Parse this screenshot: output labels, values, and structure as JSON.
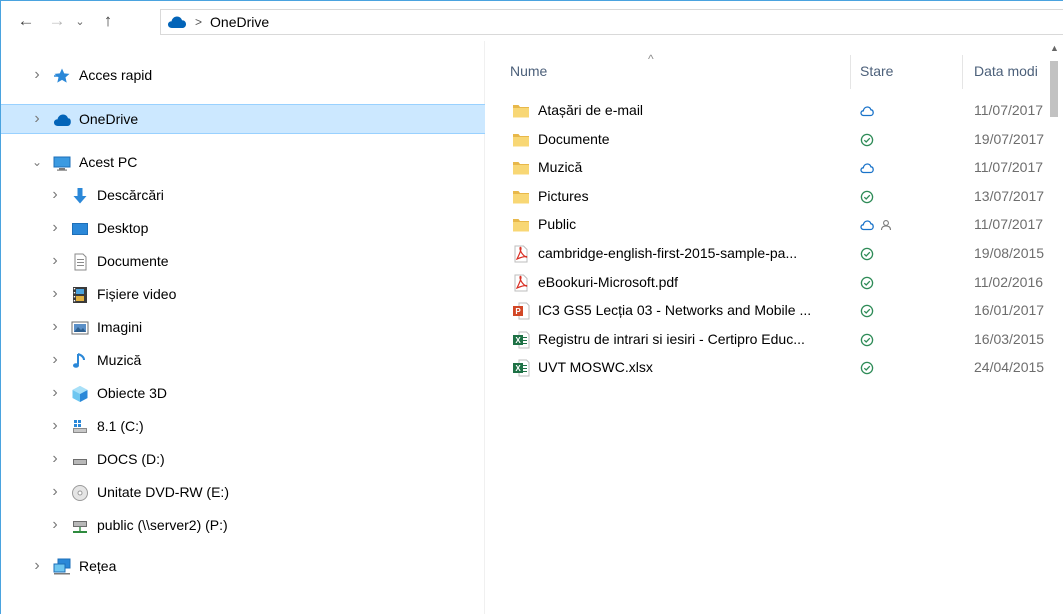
{
  "window": {
    "address": {
      "breadcrumb": [
        "OneDrive"
      ],
      "separator": ">"
    },
    "nav_buttons": {
      "back": "←",
      "forward": "→",
      "recent": "⌄",
      "up": "↑"
    }
  },
  "navigation_pane": {
    "items": [
      {
        "label": "Acces rapid",
        "icon": "star-icon",
        "expanded": false,
        "level": 0
      },
      {
        "label": "OneDrive",
        "icon": "onedrive-cloud-icon",
        "expanded": false,
        "level": 0,
        "selected": true
      },
      {
        "label": "Acest PC",
        "icon": "computer-icon",
        "expanded": true,
        "level": 0
      },
      {
        "label": "Descărcări",
        "icon": "download-arrow-icon",
        "expanded": false,
        "level": 1
      },
      {
        "label": "Desktop",
        "icon": "desktop-icon",
        "expanded": false,
        "level": 1
      },
      {
        "label": "Documente",
        "icon": "document-icon",
        "expanded": false,
        "level": 1
      },
      {
        "label": "Fișiere video",
        "icon": "video-film-icon",
        "expanded": false,
        "level": 1
      },
      {
        "label": "Imagini",
        "icon": "pictures-icon",
        "expanded": false,
        "level": 1
      },
      {
        "label": "Muzică",
        "icon": "music-note-icon",
        "expanded": false,
        "level": 1
      },
      {
        "label": "Obiecte 3D",
        "icon": "cube-3d-icon",
        "expanded": false,
        "level": 1
      },
      {
        "label": "8.1 (C:)",
        "icon": "windows-drive-icon",
        "expanded": false,
        "level": 1
      },
      {
        "label": "DOCS (D:)",
        "icon": "drive-icon",
        "expanded": false,
        "level": 1
      },
      {
        "label": "Unitate DVD-RW (E:)",
        "icon": "dvd-icon",
        "expanded": false,
        "level": 1
      },
      {
        "label": "public (\\\\server2) (P:)",
        "icon": "network-drive-icon",
        "expanded": false,
        "level": 1
      },
      {
        "label": "Rețea",
        "icon": "network-icon",
        "expanded": false,
        "level": 0
      }
    ]
  },
  "content": {
    "columns": {
      "name": "Nume",
      "status": "Stare",
      "date": "Data modi"
    },
    "files": [
      {
        "name": "Atașări de e-mail",
        "type": "folder",
        "status": [
          "cloud"
        ],
        "date": "11/07/2017"
      },
      {
        "name": "Documente",
        "type": "folder",
        "status": [
          "synced"
        ],
        "date": "19/07/2017"
      },
      {
        "name": "Muzică",
        "type": "folder",
        "status": [
          "cloud"
        ],
        "date": "11/07/2017"
      },
      {
        "name": "Pictures",
        "type": "folder",
        "status": [
          "synced"
        ],
        "date": "13/07/2017"
      },
      {
        "name": "Public",
        "type": "folder",
        "status": [
          "cloud",
          "shared"
        ],
        "date": "11/07/2017"
      },
      {
        "name": "cambridge-english-first-2015-sample-pa...",
        "type": "pdf",
        "status": [
          "synced"
        ],
        "date": "19/08/2015"
      },
      {
        "name": "eBookuri-Microsoft.pdf",
        "type": "pdf",
        "status": [
          "synced"
        ],
        "date": "11/02/2016"
      },
      {
        "name": "IC3 GS5 Lecția 03 - Networks and Mobile ...",
        "type": "pptx",
        "status": [
          "synced"
        ],
        "date": "16/01/2017"
      },
      {
        "name": "Registru de intrari si iesiri - Certipro Educ...",
        "type": "xlsx",
        "status": [
          "synced"
        ],
        "date": "16/03/2015"
      },
      {
        "name": "UVT MOSWC.xlsx",
        "type": "xlsx",
        "status": [
          "synced"
        ],
        "date": "24/04/2015"
      }
    ]
  },
  "colors": {
    "selection_bg": "#cce8ff",
    "onedrive_blue": "#0364b8",
    "status_cloud": "#1a73c9",
    "status_synced": "#2e8b57",
    "folder_yellow": "#f8d775"
  }
}
